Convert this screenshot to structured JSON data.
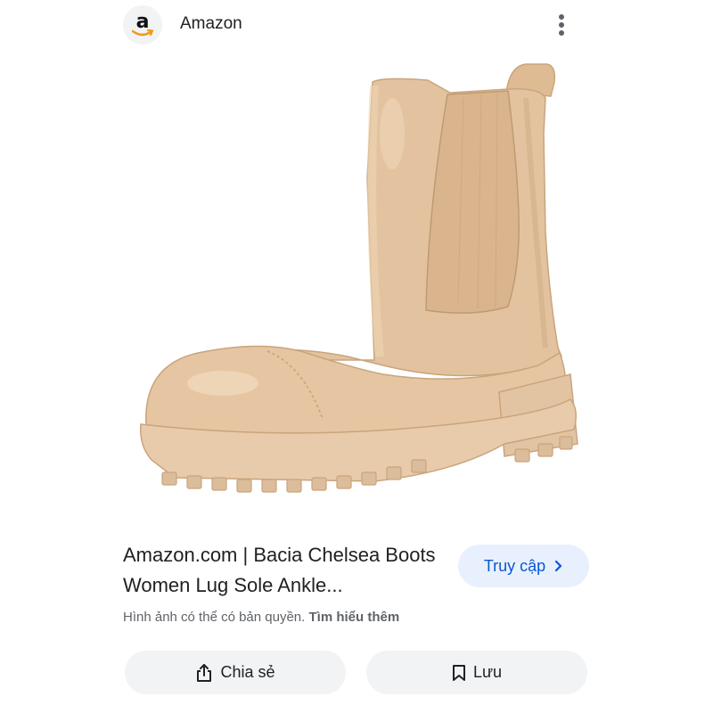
{
  "header": {
    "source_logo_letter": "a",
    "source_name": "Amazon"
  },
  "image": {
    "subject": "boot-photo",
    "colors": {
      "leather": "#e2c19c",
      "sole": "#e6c8a8",
      "elastic": "#d8b28a"
    }
  },
  "result": {
    "title": "Amazon.com | Bacia Chelsea Boots Women Lug Sole Ankle...",
    "visit_label": "Truy cập",
    "copyright_text": "Hình ảnh có thể có bản quyền.",
    "learn_more_label": "Tìm hiểu thêm"
  },
  "actions": {
    "share_label": "Chia sẻ",
    "save_label": "Lưu"
  },
  "theme": {
    "accent": "#0b57d0",
    "accent_bg": "#e8f0fe",
    "button_bg": "#f1f3f4"
  }
}
